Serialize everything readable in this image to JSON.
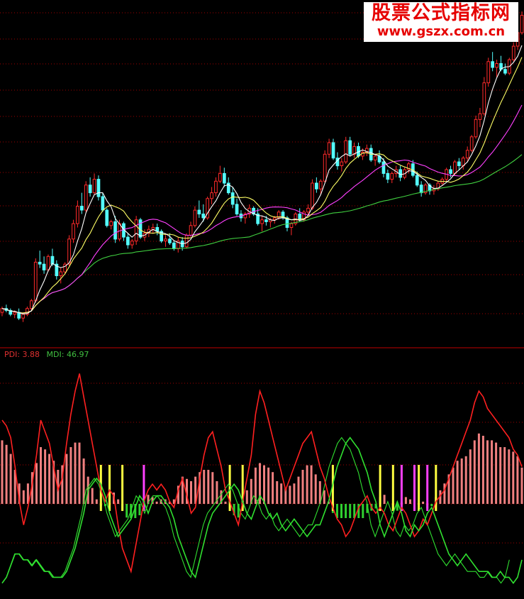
{
  "watermark": {
    "title": "股票公式指标网",
    "url": "www.gszx.com.cn"
  },
  "indicator": {
    "pdi_label": "PDI: 3.88",
    "mdi_label": "MDI: 46.97",
    "pdi": 3.88,
    "mdi": 46.97
  },
  "colors": {
    "up": "#ff2a2a",
    "down": "#54ffff",
    "ma5": "#ffffff",
    "ma10": "#ffff66",
    "ma20": "#ff40ff",
    "ma60": "#40d040",
    "pdi": "#ff2020",
    "mdi": "#30e030",
    "grid": "#a00000",
    "hist_pos": "#f08080",
    "hist_neg": "#30d030",
    "marker": "#ffff40",
    "marker_alt": "#ff40ff"
  },
  "chart_data": [
    {
      "type": "candlestick",
      "title": "",
      "grid": true,
      "candles": [
        [
          10.6,
          10.9,
          10.4,
          10.8
        ],
        [
          10.8,
          11.0,
          10.6,
          10.7
        ],
        [
          10.7,
          10.8,
          10.4,
          10.5
        ],
        [
          10.5,
          10.7,
          10.3,
          10.6
        ],
        [
          10.6,
          10.8,
          10.2,
          10.3
        ],
        [
          10.3,
          10.6,
          10.1,
          10.5
        ],
        [
          10.5,
          10.9,
          10.4,
          10.8
        ],
        [
          10.8,
          11.3,
          10.7,
          11.2
        ],
        [
          11.2,
          13.4,
          11.1,
          13.2
        ],
        [
          13.2,
          13.8,
          12.9,
          13.1
        ],
        [
          13.1,
          13.5,
          12.6,
          12.8
        ],
        [
          12.8,
          13.6,
          12.7,
          13.5
        ],
        [
          13.5,
          13.9,
          13.0,
          13.1
        ],
        [
          13.1,
          13.3,
          12.3,
          12.5
        ],
        [
          12.5,
          12.9,
          12.1,
          12.7
        ],
        [
          12.7,
          13.2,
          12.6,
          13.1
        ],
        [
          13.1,
          14.6,
          13.0,
          14.4
        ],
        [
          14.4,
          15.4,
          14.2,
          15.2
        ],
        [
          15.2,
          16.4,
          15.0,
          16.1
        ],
        [
          16.1,
          16.8,
          15.7,
          15.9
        ],
        [
          15.9,
          17.4,
          15.8,
          17.2
        ],
        [
          17.2,
          17.6,
          16.6,
          16.8
        ],
        [
          16.8,
          17.8,
          16.7,
          17.5
        ],
        [
          17.5,
          17.7,
          16.4,
          16.6
        ],
        [
          16.6,
          16.8,
          15.8,
          15.9
        ],
        [
          15.9,
          16.0,
          15.0,
          15.1
        ],
        [
          15.1,
          15.4,
          14.9,
          15.3
        ],
        [
          15.3,
          15.6,
          14.2,
          14.4
        ],
        [
          14.4,
          15.4,
          14.3,
          15.2
        ],
        [
          15.2,
          15.3,
          14.3,
          14.5
        ],
        [
          14.5,
          14.7,
          13.9,
          14.1
        ],
        [
          14.1,
          14.4,
          13.9,
          14.3
        ],
        [
          14.3,
          15.6,
          14.1,
          15.4
        ],
        [
          15.4,
          15.5,
          14.4,
          14.5
        ],
        [
          14.5,
          14.9,
          14.3,
          14.7
        ],
        [
          14.7,
          15.1,
          14.5,
          14.9
        ],
        [
          14.9,
          15.2,
          14.7,
          15.0
        ],
        [
          15.0,
          15.2,
          14.6,
          14.8
        ],
        [
          14.8,
          14.9,
          14.2,
          14.3
        ],
        [
          14.3,
          14.6,
          14.0,
          14.4
        ],
        [
          14.4,
          14.7,
          14.1,
          14.2
        ],
        [
          14.2,
          14.3,
          13.8,
          13.9
        ],
        [
          13.9,
          14.5,
          13.7,
          14.3
        ],
        [
          14.3,
          14.5,
          13.8,
          14.0
        ],
        [
          14.0,
          14.7,
          13.9,
          14.6
        ],
        [
          14.6,
          15.3,
          14.5,
          15.1
        ],
        [
          15.1,
          16.1,
          15.0,
          15.9
        ],
        [
          15.9,
          16.4,
          15.5,
          15.7
        ],
        [
          15.7,
          16.2,
          15.3,
          15.5
        ],
        [
          15.5,
          16.6,
          15.4,
          16.5
        ],
        [
          16.5,
          17.1,
          16.2,
          16.8
        ],
        [
          16.8,
          17.6,
          16.6,
          17.4
        ],
        [
          17.4,
          18.2,
          17.3,
          17.8
        ],
        [
          17.8,
          18.1,
          17.1,
          17.3
        ],
        [
          17.3,
          17.6,
          16.7,
          16.8
        ],
        [
          16.8,
          17.1,
          16.0,
          16.2
        ],
        [
          16.2,
          16.5,
          15.6,
          15.7
        ],
        [
          15.7,
          15.9,
          15.3,
          15.5
        ],
        [
          15.5,
          15.8,
          15.2,
          15.7
        ],
        [
          15.7,
          16.2,
          15.5,
          16.0
        ],
        [
          16.0,
          16.1,
          15.6,
          15.7
        ],
        [
          15.7,
          16.0,
          15.1,
          15.2
        ],
        [
          15.2,
          15.6,
          14.8,
          15.4
        ],
        [
          15.4,
          15.6,
          15.1,
          15.3
        ],
        [
          15.3,
          15.5,
          15.0,
          15.4
        ],
        [
          15.4,
          15.6,
          15.2,
          15.5
        ],
        [
          15.5,
          15.9,
          15.4,
          15.8
        ],
        [
          15.8,
          15.9,
          15.4,
          15.5
        ],
        [
          15.5,
          15.6,
          14.8,
          15.0
        ],
        [
          15.0,
          15.3,
          14.6,
          15.2
        ],
        [
          15.2,
          15.8,
          15.1,
          15.7
        ],
        [
          15.7,
          16.0,
          15.3,
          15.4
        ],
        [
          15.4,
          15.9,
          15.3,
          15.8
        ],
        [
          15.8,
          16.2,
          15.6,
          16.0
        ],
        [
          16.0,
          17.5,
          15.9,
          17.3
        ],
        [
          17.3,
          17.6,
          16.8,
          17.0
        ],
        [
          17.0,
          17.5,
          16.7,
          17.4
        ],
        [
          17.4,
          19.0,
          17.3,
          18.8
        ],
        [
          18.8,
          19.6,
          18.6,
          19.4
        ],
        [
          19.4,
          19.6,
          18.5,
          18.6
        ],
        [
          18.6,
          18.9,
          18.0,
          18.2
        ],
        [
          18.2,
          18.6,
          17.9,
          18.4
        ],
        [
          18.4,
          19.7,
          18.3,
          19.5
        ],
        [
          19.5,
          19.7,
          18.7,
          18.8
        ],
        [
          18.8,
          19.4,
          18.6,
          19.2
        ],
        [
          19.2,
          19.4,
          18.6,
          18.7
        ],
        [
          18.7,
          19.1,
          18.5,
          18.9
        ],
        [
          18.9,
          19.3,
          18.7,
          19.1
        ],
        [
          19.1,
          19.3,
          18.4,
          18.5
        ],
        [
          18.5,
          18.8,
          18.2,
          18.7
        ],
        [
          18.7,
          19.0,
          18.3,
          18.4
        ],
        [
          18.4,
          18.6,
          17.6,
          17.8
        ],
        [
          17.8,
          18.0,
          17.3,
          17.5
        ],
        [
          17.5,
          17.9,
          17.3,
          17.8
        ],
        [
          17.8,
          18.2,
          17.6,
          18.0
        ],
        [
          18.0,
          18.2,
          17.4,
          17.6
        ],
        [
          17.6,
          18.1,
          17.5,
          18.0
        ],
        [
          18.0,
          18.4,
          17.8,
          18.3
        ],
        [
          18.3,
          18.5,
          17.6,
          17.7
        ],
        [
          17.7,
          17.9,
          17.1,
          17.2
        ],
        [
          17.2,
          17.4,
          16.6,
          16.8
        ],
        [
          16.8,
          17.3,
          16.7,
          17.2
        ],
        [
          17.2,
          17.3,
          16.7,
          16.9
        ],
        [
          16.9,
          17.2,
          16.7,
          17.0
        ],
        [
          17.0,
          17.4,
          16.9,
          17.3
        ],
        [
          17.3,
          17.6,
          17.2,
          17.5
        ],
        [
          17.5,
          18.1,
          17.4,
          18.0
        ],
        [
          18.0,
          18.2,
          17.6,
          17.8
        ],
        [
          17.8,
          18.5,
          17.7,
          18.4
        ],
        [
          18.4,
          18.6,
          18.0,
          18.2
        ],
        [
          18.2,
          18.7,
          18.0,
          18.6
        ],
        [
          18.6,
          19.2,
          18.4,
          19.0
        ],
        [
          19.0,
          19.8,
          18.9,
          19.7
        ],
        [
          19.7,
          20.8,
          19.6,
          20.6
        ],
        [
          20.6,
          21.2,
          20.2,
          20.9
        ],
        [
          20.9,
          22.8,
          20.8,
          22.5
        ],
        [
          22.5,
          23.8,
          22.3,
          23.6
        ],
        [
          23.6,
          24.1,
          23.1,
          23.3
        ],
        [
          23.3,
          23.7,
          22.8,
          23.5
        ],
        [
          23.5,
          23.9,
          23.1,
          23.2
        ],
        [
          23.2,
          23.5,
          22.9,
          23.0
        ],
        [
          23.0,
          23.8,
          22.9,
          23.7
        ],
        [
          23.7,
          24.6,
          23.6,
          24.4
        ],
        [
          24.4,
          25.3,
          24.2,
          25.1
        ],
        [
          25.1,
          26.2,
          25.0,
          26.0
        ]
      ],
      "ylim": [
        9.5,
        26.5
      ]
    },
    {
      "type": "line",
      "title": "",
      "grid": true,
      "series": [
        {
          "key": "pdi",
          "values": [
            30,
            29,
            27,
            22,
            16,
            12,
            15,
            19,
            24,
            30,
            28,
            26,
            22,
            18,
            20,
            26,
            31,
            35,
            38,
            34,
            30,
            26,
            22,
            18,
            16,
            18,
            17,
            12,
            8,
            6,
            4,
            8,
            12,
            16,
            18,
            19,
            18,
            19,
            18,
            16,
            15,
            18,
            20,
            17,
            14,
            15,
            20,
            24,
            27,
            28,
            25,
            22,
            18,
            16,
            14,
            12,
            16,
            20,
            24,
            31,
            35,
            33,
            30,
            27,
            24,
            21,
            18,
            20,
            22,
            24,
            26,
            27,
            28,
            25,
            22,
            20,
            17,
            15,
            13,
            12,
            10,
            11,
            13,
            15,
            16,
            17,
            15,
            14,
            15,
            14,
            12,
            11,
            13,
            15,
            14,
            12,
            10,
            11,
            13,
            12,
            14,
            16,
            17,
            18,
            20,
            22,
            24,
            26,
            28,
            30,
            33,
            35,
            34,
            32,
            31,
            30,
            29,
            28,
            27,
            25,
            24,
            22
          ]
        },
        {
          "key": "mdi",
          "values": [
            2,
            3,
            5,
            7,
            7,
            6,
            6,
            5,
            6,
            5,
            4,
            4,
            3,
            3,
            3,
            4,
            6,
            8,
            11,
            14,
            18,
            19,
            20,
            19,
            17,
            14,
            12,
            10,
            11,
            12,
            13,
            15,
            17,
            16,
            14,
            16,
            17,
            17,
            16,
            15,
            13,
            10,
            8,
            6,
            4,
            3,
            6,
            9,
            12,
            14,
            15,
            16,
            17,
            18,
            19,
            18,
            16,
            14,
            13,
            15,
            17,
            16,
            14,
            13,
            14,
            12,
            11,
            12,
            13,
            12,
            11,
            10,
            11,
            12,
            12,
            14,
            16,
            19,
            22,
            24,
            26,
            27,
            26,
            25,
            23,
            21,
            18,
            16,
            12,
            10,
            12,
            14,
            16,
            14,
            11,
            10,
            12,
            11,
            12,
            14,
            15,
            13,
            11,
            9,
            7,
            6,
            5,
            6,
            7,
            6,
            5,
            4,
            4,
            4,
            3,
            3,
            4,
            3,
            3,
            2,
            3,
            6
          ]
        }
      ],
      "ylim": [
        0,
        40
      ]
    }
  ]
}
